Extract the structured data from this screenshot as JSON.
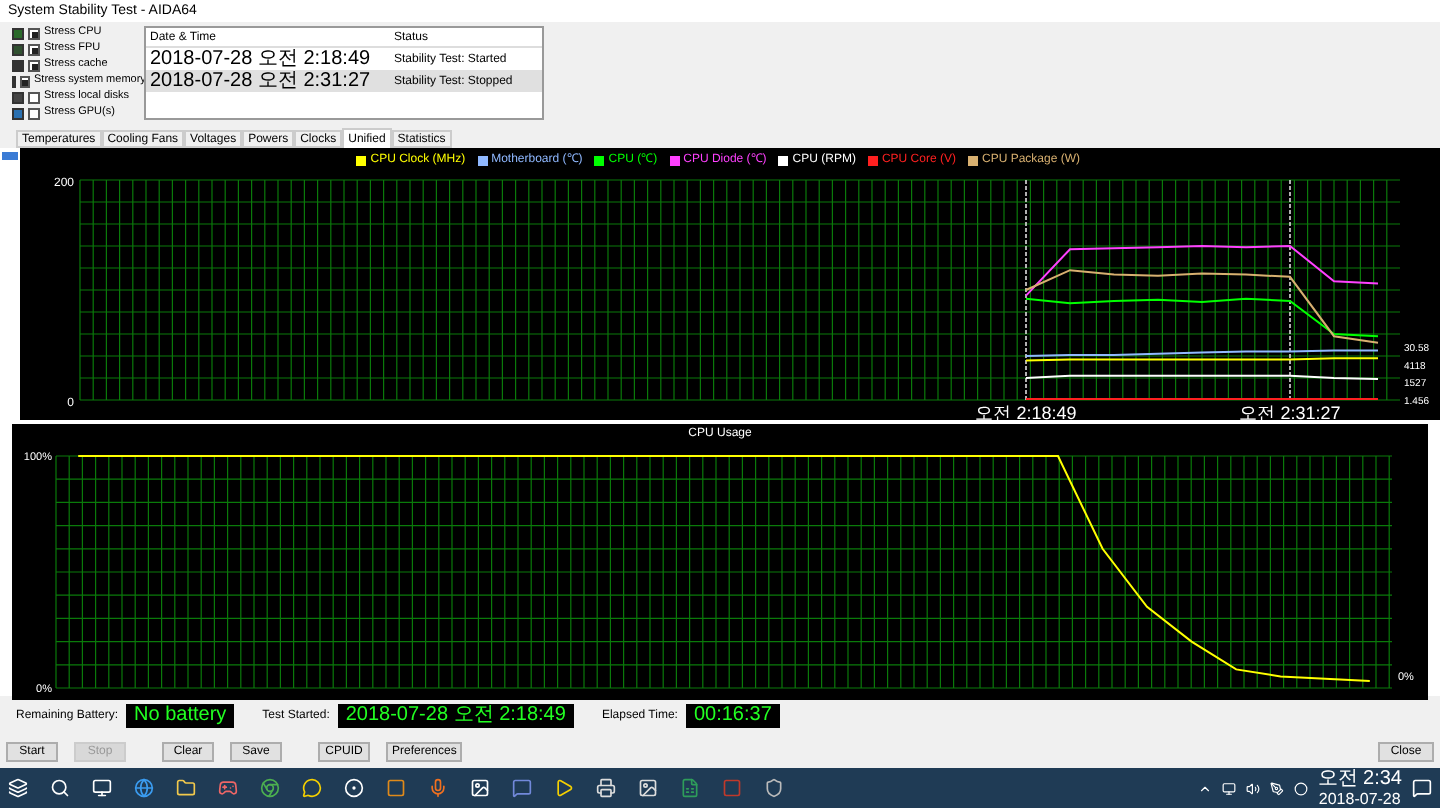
{
  "window": {
    "title": "System Stability Test - AIDA64"
  },
  "stress_options": [
    {
      "label": "Stress CPU",
      "checked": true,
      "kind": "cpu"
    },
    {
      "label": "Stress FPU",
      "checked": true,
      "kind": "fpu"
    },
    {
      "label": "Stress cache",
      "checked": true,
      "kind": "cache"
    },
    {
      "label": "Stress system memory",
      "checked": true,
      "kind": "memory"
    },
    {
      "label": "Stress local disks",
      "checked": false,
      "kind": "disk"
    },
    {
      "label": "Stress GPU(s)",
      "checked": false,
      "kind": "gpu"
    }
  ],
  "log": {
    "columns": [
      "Date & Time",
      "Status"
    ],
    "rows": [
      {
        "cells": [
          "2018-07-28 오전 2:18:49",
          "Stability Test: Started"
        ],
        "selected": false
      },
      {
        "cells": [
          "2018-07-28 오전 2:31:27",
          "Stability Test: Stopped"
        ],
        "selected": true
      }
    ]
  },
  "tabs": [
    {
      "label": "Temperatures",
      "selected": false
    },
    {
      "label": "Cooling Fans",
      "selected": false
    },
    {
      "label": "Voltages",
      "selected": false
    },
    {
      "label": "Powers",
      "selected": false
    },
    {
      "label": "Clocks",
      "selected": false
    },
    {
      "label": "Unified",
      "selected": true
    },
    {
      "label": "Statistics",
      "selected": false
    }
  ],
  "sensor_chart": {
    "chart_data": {
      "type": "line",
      "legend": "top",
      "grid": true,
      "categories": [
        null,
        null,
        null,
        null,
        null,
        null,
        null,
        null,
        null,
        null,
        null,
        null,
        null,
        null,
        null,
        null,
        null,
        null,
        null,
        null,
        null,
        "오전 2:18:49",
        null,
        null,
        null,
        null,
        null,
        "오전 2:31:27",
        null,
        null
      ],
      "ylim": [
        0,
        200
      ],
      "yticks": [
        0,
        200
      ],
      "series": [
        {
          "name": "CPU Clock (MHz)",
          "color": "#ffff00",
          "values": [
            null,
            null,
            null,
            null,
            null,
            null,
            null,
            null,
            null,
            null,
            null,
            null,
            null,
            null,
            null,
            null,
            null,
            null,
            null,
            null,
            null,
            36,
            37,
            37,
            37,
            37,
            37,
            37,
            38,
            38
          ]
        },
        {
          "name": "Motherboard (℃)",
          "color": "#8fb8ff",
          "values": [
            null,
            null,
            null,
            null,
            null,
            null,
            null,
            null,
            null,
            null,
            null,
            null,
            null,
            null,
            null,
            null,
            null,
            null,
            null,
            null,
            null,
            40,
            41,
            41,
            42,
            43,
            44,
            44,
            45,
            45
          ]
        },
        {
          "name": "CPU (℃)",
          "color": "#00ff00",
          "values": [
            null,
            null,
            null,
            null,
            null,
            null,
            null,
            null,
            null,
            null,
            null,
            null,
            null,
            null,
            null,
            null,
            null,
            null,
            null,
            null,
            null,
            92,
            88,
            90,
            91,
            89,
            92,
            90,
            60,
            58
          ]
        },
        {
          "name": "CPU Diode (℃)",
          "color": "#ff40ff",
          "values": [
            null,
            null,
            null,
            null,
            null,
            null,
            null,
            null,
            null,
            null,
            null,
            null,
            null,
            null,
            null,
            null,
            null,
            null,
            null,
            null,
            null,
            95,
            137,
            138,
            139,
            140,
            139,
            140,
            108,
            106
          ]
        },
        {
          "name": "CPU (RPM)",
          "color": "#ffffff",
          "values": [
            null,
            null,
            null,
            null,
            null,
            null,
            null,
            null,
            null,
            null,
            null,
            null,
            null,
            null,
            null,
            null,
            null,
            null,
            null,
            null,
            null,
            20,
            22,
            22,
            22,
            22,
            22,
            22,
            20,
            19
          ]
        },
        {
          "name": "CPU Core (V)",
          "color": "#ff2020",
          "values": [
            null,
            null,
            null,
            null,
            null,
            null,
            null,
            null,
            null,
            null,
            null,
            null,
            null,
            null,
            null,
            null,
            null,
            null,
            null,
            null,
            null,
            1,
            1,
            1,
            1,
            1,
            1,
            1,
            1,
            1
          ]
        },
        {
          "name": "CPU Package (W)",
          "color": "#d8b070",
          "values": [
            null,
            null,
            null,
            null,
            null,
            null,
            null,
            null,
            null,
            null,
            null,
            null,
            null,
            null,
            null,
            null,
            null,
            null,
            null,
            null,
            null,
            100,
            118,
            114,
            113,
            115,
            114,
            112,
            58,
            52
          ]
        }
      ],
      "annotations": [
        "30.58",
        "4118",
        "1527",
        "1.456"
      ]
    }
  },
  "usage_chart": {
    "chart_data": {
      "type": "line",
      "title": "CPU Usage",
      "grid": true,
      "categories": [
        null,
        null,
        null,
        null,
        null,
        null,
        null,
        null,
        null,
        null,
        null,
        null,
        null,
        null,
        null,
        null,
        null,
        null,
        null,
        null,
        null,
        null,
        null,
        null,
        null,
        null,
        null,
        null,
        null,
        null
      ],
      "ylim": [
        0,
        100
      ],
      "yticks": [
        {
          "value": 100,
          "label": "100%"
        },
        {
          "value": 0,
          "label": "0%"
        }
      ],
      "series": [
        {
          "color": "#ffff00",
          "values": [
            100,
            100,
            100,
            100,
            100,
            100,
            100,
            100,
            100,
            100,
            100,
            100,
            100,
            100,
            100,
            100,
            100,
            100,
            100,
            100,
            100,
            100,
            100,
            60,
            35,
            20,
            8,
            5,
            4,
            3
          ]
        }
      ],
      "annotations": [
        "0%"
      ]
    }
  },
  "status": [
    {
      "label": "Remaining Battery:",
      "value": "No battery"
    },
    {
      "label": "Test Started:",
      "value": "2018-07-28 오전 2:18:49"
    },
    {
      "label": "Elapsed Time:",
      "value": "00:16:37"
    }
  ],
  "buttons": [
    {
      "label": "Start",
      "disabled": false
    },
    {
      "label": "Stop",
      "disabled": true
    },
    {
      "label": "Clear",
      "disabled": false
    },
    {
      "label": "Save",
      "disabled": false
    },
    {
      "label": "CPUID",
      "disabled": false
    },
    {
      "label": "Preferences",
      "disabled": false
    }
  ],
  "close_button": "Close",
  "taskbar": {
    "time": "오전 2:34",
    "date": "2018-07-28"
  }
}
